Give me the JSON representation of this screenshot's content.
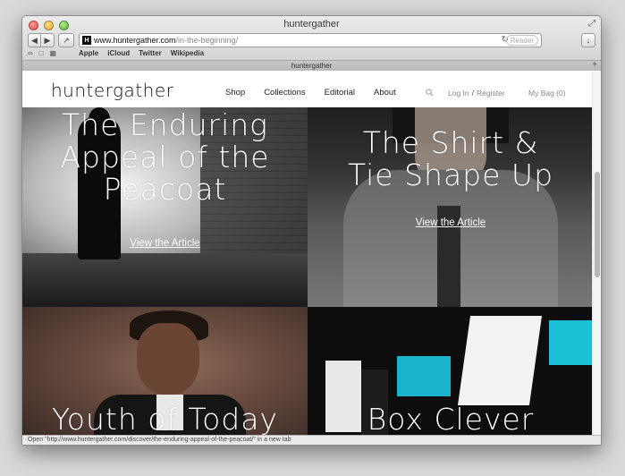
{
  "window": {
    "title": "huntergather"
  },
  "toolbar": {
    "back_icon": "back-arrow-icon",
    "forward_icon": "forward-arrow-icon",
    "url_host": "www.huntergather.com",
    "url_path": "/in-the-beginning/",
    "reader_label": "Reader"
  },
  "bookmarks": [
    "Apple",
    "iCloud",
    "Twitter",
    "Wikipedia"
  ],
  "tab": {
    "title": "huntergather"
  },
  "site": {
    "logo": "huntergather",
    "menu": [
      "Shop",
      "Collections",
      "Editorial",
      "About"
    ],
    "login": "Log In",
    "separator": "/",
    "register": "Register",
    "bag": "My Bag (0)"
  },
  "tiles": [
    {
      "title": [
        "The Enduring",
        "Appeal of the",
        "Peacoat"
      ],
      "link": "View the Article"
    },
    {
      "title": [
        "The Shirt &",
        "Tie Shape Up"
      ],
      "link": "View the Article"
    },
    {
      "title": [
        "Youth of Today"
      ]
    },
    {
      "title": [
        "Box Clever"
      ]
    }
  ],
  "status": "Open \"http://www.huntergather.com/discover/the-enduring-appeal-of-the-peacoat/\" in a new tab"
}
